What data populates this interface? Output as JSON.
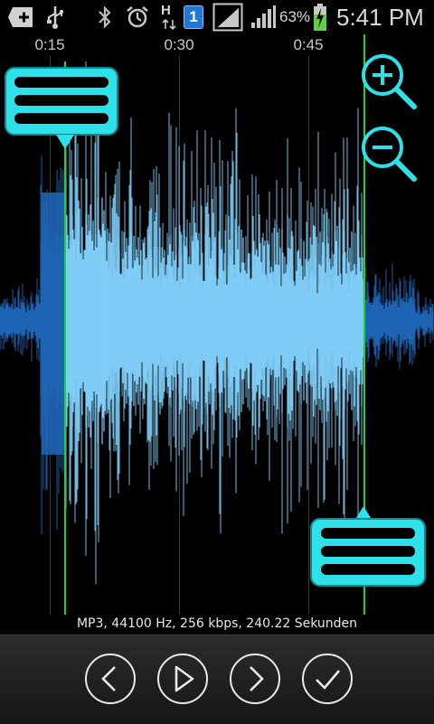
{
  "status_bar": {
    "battery_percent": "63%",
    "time": "5:41 PM",
    "sim_badge": "1",
    "network_h": "H",
    "icons": [
      "plus-box-icon",
      "usb-icon",
      "bluetooth-icon",
      "alarm-clock-icon",
      "network-h-icon",
      "sim-badge-icon",
      "signal-box-icon",
      "signal-icon",
      "battery-charging-icon"
    ]
  },
  "timeline": {
    "labels": [
      "0:15",
      "0:30",
      "0:45"
    ]
  },
  "waveform": {
    "selected_color": "#7fccf6",
    "unselected_color": "#1e64b4",
    "marker_color": "#19d62e"
  },
  "handles": {
    "color": "#2ee0e8"
  },
  "zoom": {
    "zoom_in_icon": "zoom-in-icon",
    "zoom_out_icon": "zoom-out-icon"
  },
  "info": {
    "text": "MP3, 44100 Hz, 256 kbps, 240.22 Sekunden"
  },
  "controls": {
    "buttons": [
      "previous-button",
      "play-button",
      "next-button",
      "save-button"
    ]
  }
}
